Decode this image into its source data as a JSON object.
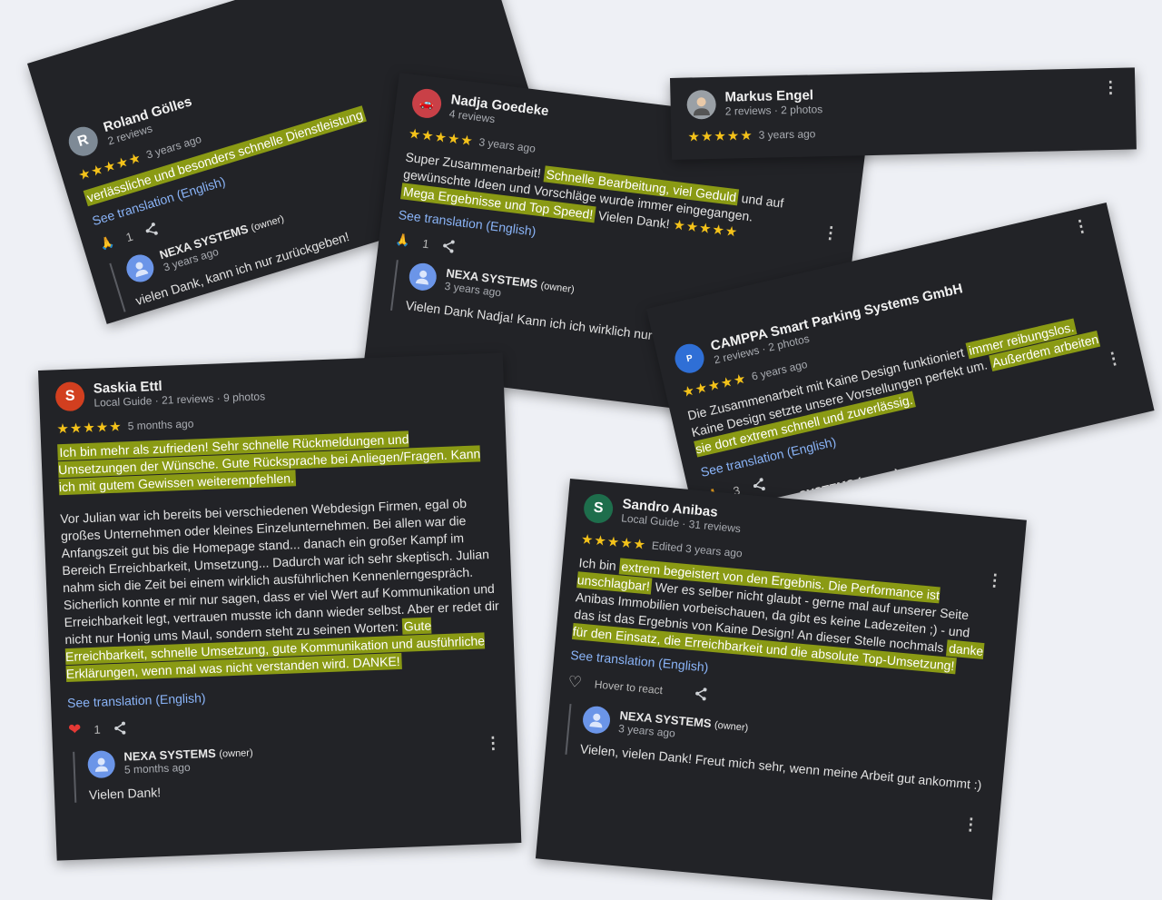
{
  "cards": {
    "roland": {
      "name": "Roland Gölles",
      "meta": "2 reviews",
      "initial": "R",
      "stars": "★★★★★",
      "ago": "3 years ago",
      "text_hl": "verlässliche und besonders schnelle Dienstleistung",
      "translation": "See translation (English)",
      "react_count": "1",
      "owner_name": "NEXA SYSTEMS",
      "owner_tag": "(owner)",
      "owner_ago": "3 years ago",
      "owner_text": "vielen Dank, kann ich nur zurückgeben!"
    },
    "nadja": {
      "name": "Nadja Goedeke",
      "meta": "4 reviews",
      "stars": "★★★★★",
      "ago": "3 years ago",
      "t1": "Super Zusammenarbeit!",
      "h1": "Schnelle Bearbeitung, viel Geduld",
      "t2": "und auf gewünschte Ideen und Vorschläge wurde immer eingegangen.",
      "h2": "Mega Ergebnisse und Top Speed!",
      "t3": "Vielen Dank!",
      "inline_stars": "★★★★★",
      "translation": "See translation (English)",
      "react_count": "1",
      "owner_name": "NEXA SYSTEMS",
      "owner_tag": "(owner)",
      "owner_ago": "3 years ago",
      "owner_text": "Vielen Dank Nadja! Kann ich ich wirklich nur zurück"
    },
    "markus": {
      "name": "Markus Engel",
      "meta": "2 reviews · 2 photos",
      "stars": "★★★★★",
      "ago": "3 years ago"
    },
    "campa": {
      "name": "CAMPPA Smart Parking Systems GmbH",
      "meta": "2 reviews · 2 photos",
      "stars": "★★★★★",
      "ago": "6 years ago",
      "t1": "Die Zusammenarbeit mit Kaine Design funktioniert",
      "h1": "immer reibungslos.",
      "t2": "Kaine Design setzte unsere Vorstellungen perfekt um.",
      "h2": "Außerdem arbeiten sie dort extrem schnell und zuverlässig.",
      "translation": "See translation (English)",
      "react_count": "3",
      "owner_name": "SYSTEMS (owner)"
    },
    "saskia": {
      "name": "Saskia Ettl",
      "initial": "S",
      "meta": "Local Guide · 21 reviews · 9 photos",
      "stars": "★★★★★",
      "ago": "5 months ago",
      "h1": "Ich bin mehr als zufrieden! Sehr schnelle Rückmeldungen und Umsetzungen der Wünsche. Gute Rücksprache bei Anliegen/Fragen. Kann ich mit gutem Gewissen weiterempfehlen.",
      "t2": "Vor Julian war ich bereits bei verschiedenen Webdesign Firmen, egal ob großes Unternehmen oder kleines Einzelunternehmen. Bei allen war die Anfangszeit gut bis die Homepage stand... danach ein großer Kampf im Bereich Erreichbarkeit, Umsetzung... Dadurch war ich sehr skeptisch. Julian nahm sich die Zeit bei einem wirklich ausführlichen Kennenlerngespräch. Sicherlich konnte er mir nur sagen, dass er viel Wert auf Kommunikation und Erreichbarkeit legt, vertrauen musste ich dann wieder selbst. Aber er redet dir nicht nur Honig ums Maul, sondern steht zu seinen Worten:",
      "h2": "Gute Erreichbarkeit, schnelle Umsetzung, gute Kommunikation und ausführliche Erklärungen, wenn mal was nicht verstanden wird. DANKE!",
      "translation": "See translation (English)",
      "react_count": "1",
      "owner_name": "NEXA SYSTEMS",
      "owner_tag": "(owner)",
      "owner_ago": "5 months ago",
      "owner_text": "Vielen Dank!"
    },
    "sandro": {
      "name": "Sandro Anibas",
      "initial": "S",
      "meta": "Local Guide · 31 reviews",
      "stars": "★★★★★",
      "ago": "Edited 3 years ago",
      "t1": "Ich bin",
      "h1": "extrem begeistert von den Ergebnis. Die Performance ist unschlagbar!",
      "t2": "Wer es selber nicht glaubt - gerne mal auf unserer Seite Anibas Immobilien vorbeischauen, da gibt es keine Ladezeiten ;) - und das ist das Ergebnis von Kaine Design! An dieser Stelle nochmals",
      "h2": "danke für den Einsatz, die Erreichbarkeit und die absolute Top-Umsetzung!",
      "translation": "See translation (English)",
      "hover": "Hover to react",
      "owner_name": "NEXA SYSTEMS",
      "owner_tag": "(owner)",
      "owner_ago": "3 years ago",
      "owner_text": "Vielen, vielen Dank! Freut mich sehr, wenn meine Arbeit gut ankommt :)"
    }
  },
  "colors": {
    "card_bg": "#222327",
    "highlight": "#8a9a14",
    "link": "#8ab4f8",
    "star": "#f4c21a",
    "page_bg": "#eef0f5"
  },
  "icons": [
    "kebab-icon",
    "share-icon",
    "pray-emoji-icon",
    "heart-emoji-icon",
    "heart-outline-icon",
    "person-icon"
  ]
}
